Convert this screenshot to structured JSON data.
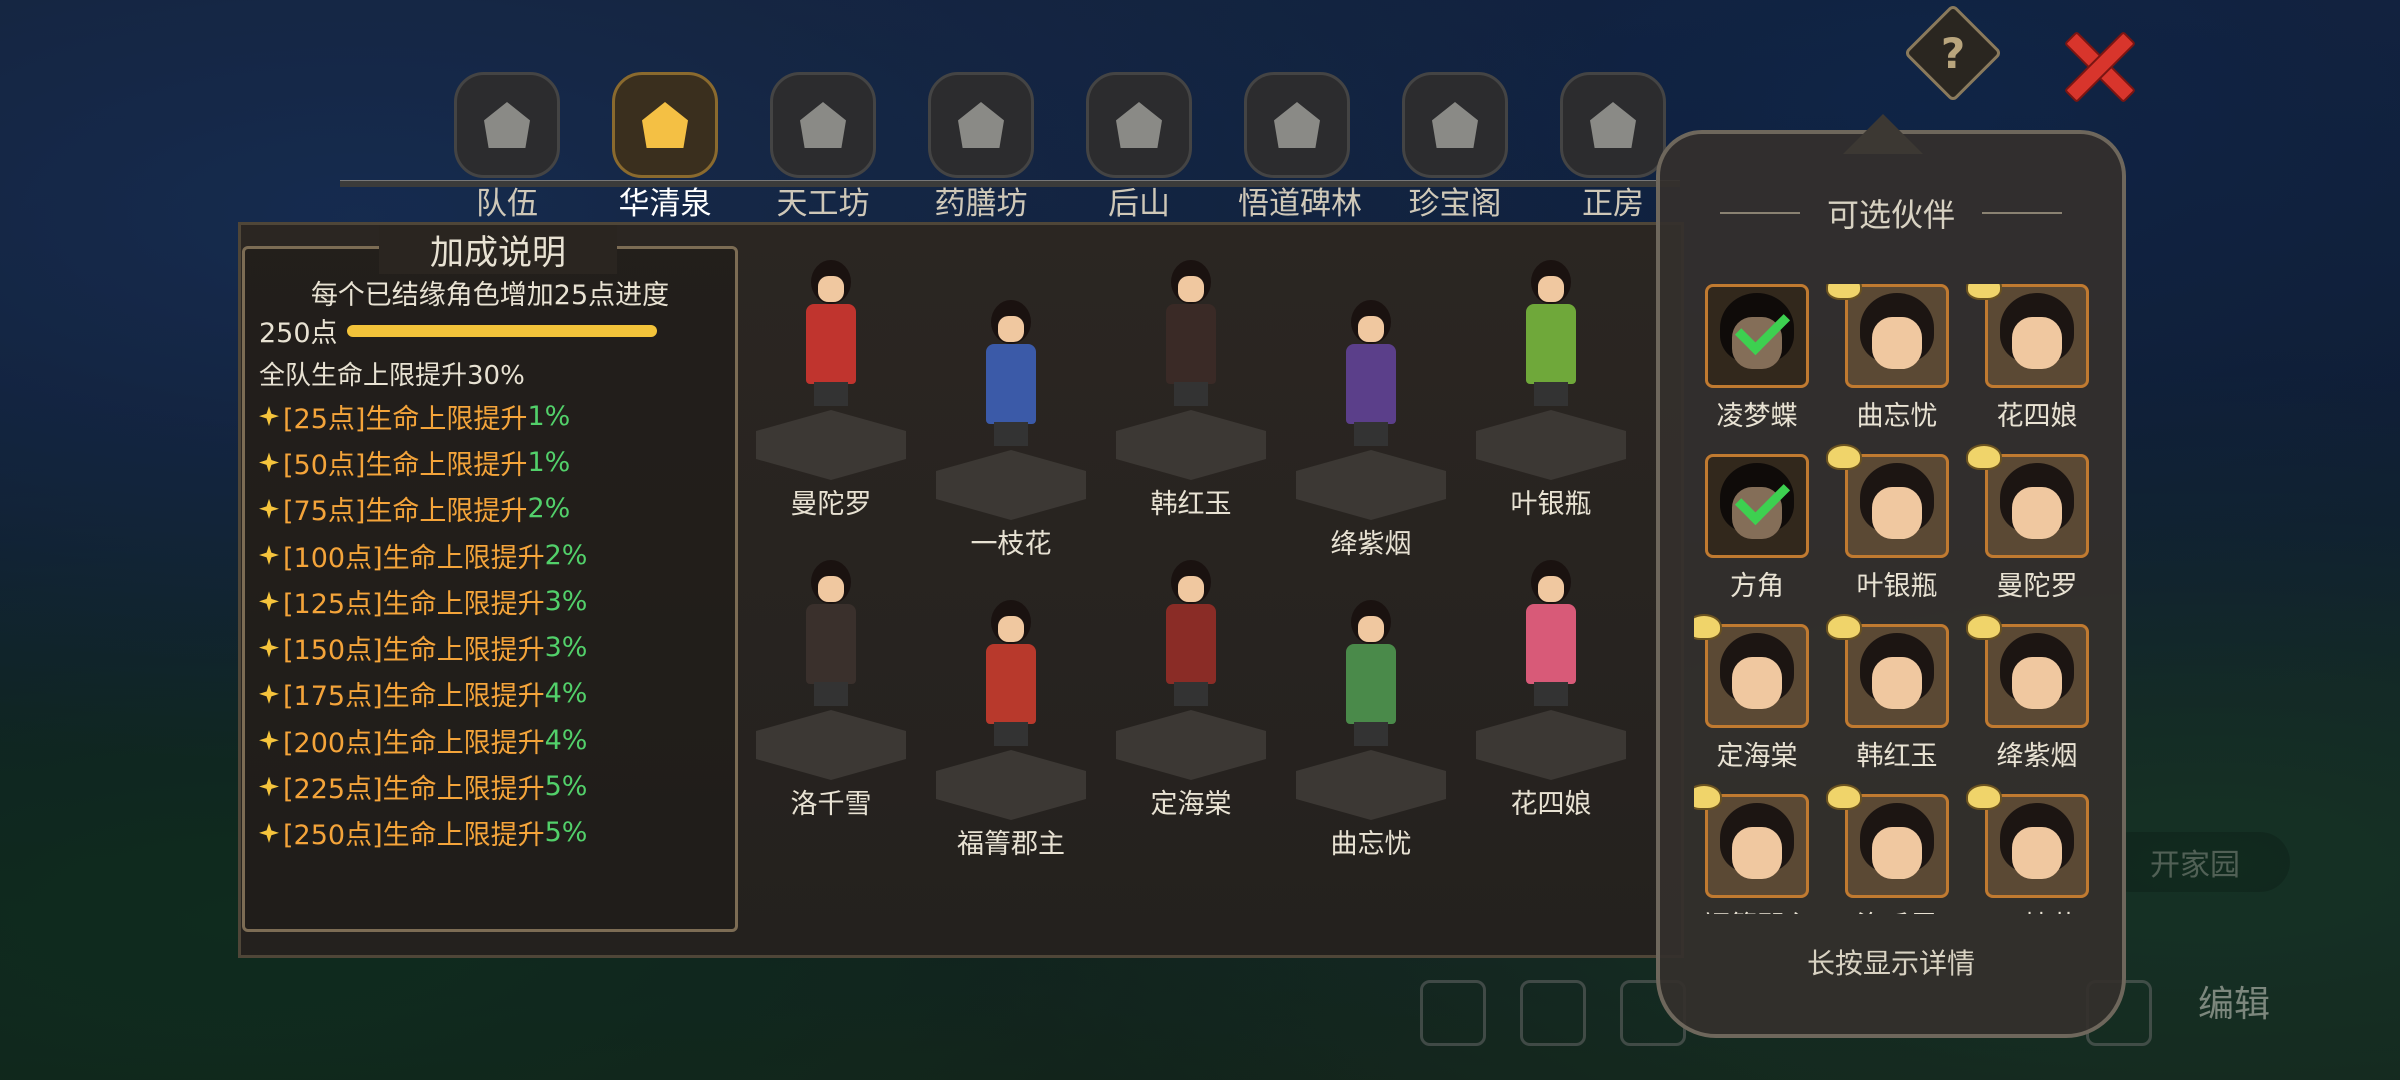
{
  "help_button": "?",
  "tabs": [
    {
      "label": "队伍",
      "icon": "team-icon",
      "active": false
    },
    {
      "label": "华清泉",
      "icon": "hot-spring-icon",
      "active": true
    },
    {
      "label": "天工坊",
      "icon": "workshop-icon",
      "active": false
    },
    {
      "label": "药膳坊",
      "icon": "kitchen-icon",
      "active": false
    },
    {
      "label": "后山",
      "icon": "mountain-icon",
      "active": false
    },
    {
      "label": "悟道碑林",
      "icon": "stele-icon",
      "active": false
    },
    {
      "label": "珍宝阁",
      "icon": "pavilion-icon",
      "active": false
    },
    {
      "label": "正房",
      "icon": "main-house-icon",
      "active": false
    }
  ],
  "bonus": {
    "title": "加成说明",
    "desc": "每个已结缘角色增加25点进度",
    "points": "250点",
    "progress": 1.0,
    "team_line": "全队生命上限提升30%",
    "tiers": [
      {
        "req": "[25点]",
        "effect": "生命上限提升",
        "pct": "1%"
      },
      {
        "req": "[50点]",
        "effect": "生命上限提升",
        "pct": "1%"
      },
      {
        "req": "[75点]",
        "effect": "生命上限提升",
        "pct": "2%"
      },
      {
        "req": "[100点]",
        "effect": "生命上限提升",
        "pct": "2%"
      },
      {
        "req": "[125点]",
        "effect": "生命上限提升",
        "pct": "3%"
      },
      {
        "req": "[150点]",
        "effect": "生命上限提升",
        "pct": "3%"
      },
      {
        "req": "[175点]",
        "effect": "生命上限提升",
        "pct": "4%"
      },
      {
        "req": "[200点]",
        "effect": "生命上限提升",
        "pct": "4%"
      },
      {
        "req": "[225点]",
        "effect": "生命上限提升",
        "pct": "5%"
      },
      {
        "req": "[250点]",
        "effect": "生命上限提升",
        "pct": "5%"
      }
    ]
  },
  "characters": [
    {
      "name": "曼陀罗",
      "color": "#c0342e"
    },
    {
      "name": "一枝花",
      "color": "#3b5aa8"
    },
    {
      "name": "韩红玉",
      "color": "#3a2a26"
    },
    {
      "name": "绛紫烟",
      "color": "#5b3f8a"
    },
    {
      "name": "叶银瓶",
      "color": "#6fa83a"
    },
    {
      "name": "洛千雪",
      "color": "#3a302c"
    },
    {
      "name": "福箐郡主",
      "color": "#b8392c"
    },
    {
      "name": "定海棠",
      "color": "#8a2c26"
    },
    {
      "name": "曲忘忧",
      "color": "#4a8a4a"
    },
    {
      "name": "花四娘",
      "color": "#d85a78"
    }
  ],
  "companions": {
    "title": "可选伙伴",
    "hint": "长按显示详情",
    "items": [
      {
        "name": "凌梦蝶",
        "selected": true
      },
      {
        "name": "曲忘忧",
        "selected": false
      },
      {
        "name": "花四娘",
        "selected": false
      },
      {
        "name": "方角",
        "selected": true
      },
      {
        "name": "叶银瓶",
        "selected": false
      },
      {
        "name": "曼陀罗",
        "selected": false
      },
      {
        "name": "定海棠",
        "selected": false
      },
      {
        "name": "韩红玉",
        "selected": false
      },
      {
        "name": "绛紫烟",
        "selected": false
      },
      {
        "name": "福箐郡主",
        "selected": false
      },
      {
        "name": "洛千雪",
        "selected": false
      },
      {
        "name": "一枝花",
        "selected": false
      }
    ]
  },
  "background": {
    "open_home": "开家园",
    "edit": "编辑"
  }
}
